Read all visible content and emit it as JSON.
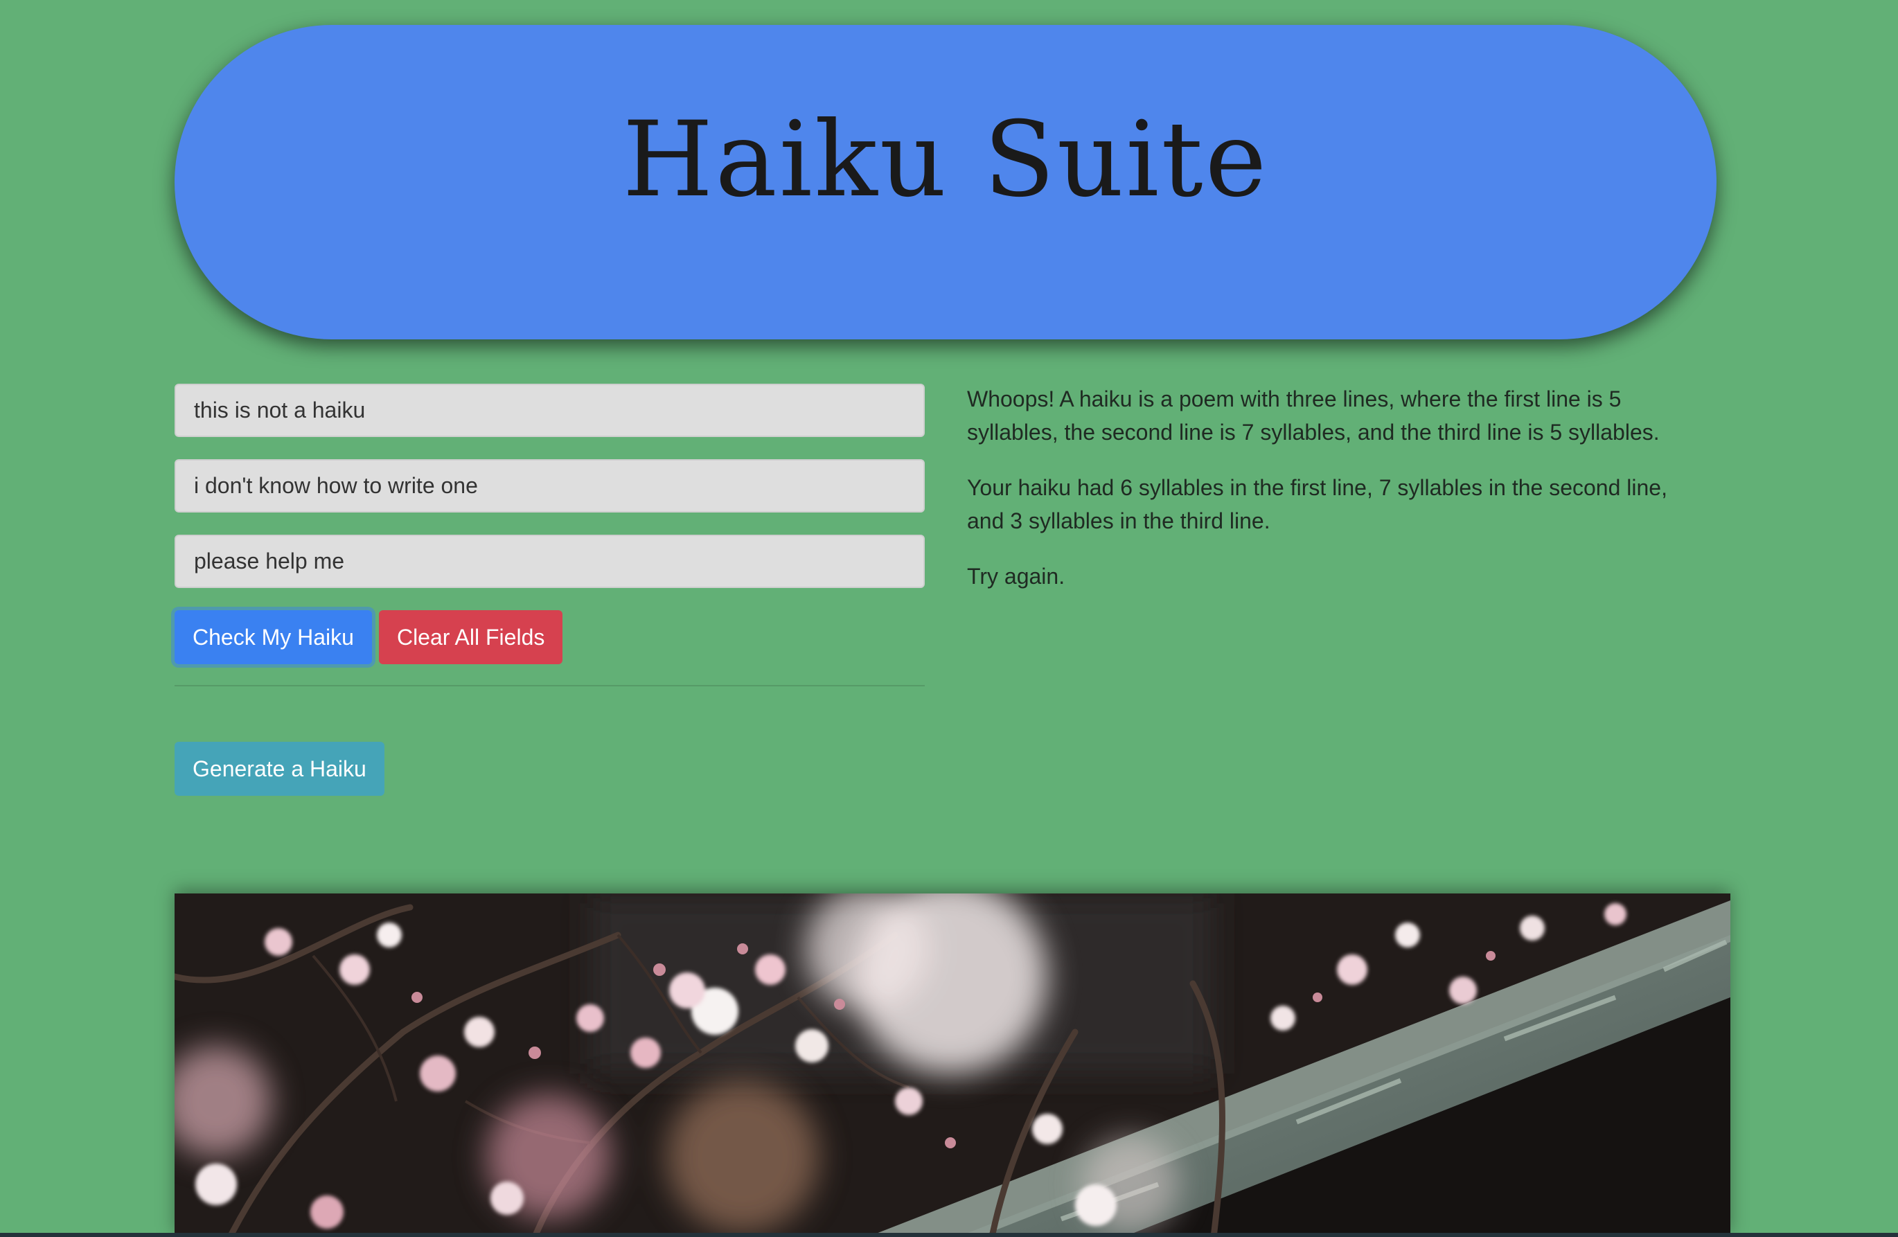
{
  "header": {
    "title": "Haiku Suite"
  },
  "form": {
    "line1_value": "this is not a haiku",
    "line2_value": "i don't know how to write one",
    "line3_value": "please help me",
    "check_label": "Check My Haiku",
    "clear_label": "Clear All Fields",
    "generate_label": "Generate a Haiku"
  },
  "result": {
    "paragraphs": [
      "Whoops! A haiku is a poem with three lines, where the first line is 5 syllables, the second line is 7 syllables, and the third line is 5 syllables.",
      "Your haiku had 6 syllables in the first line, 7 syllables in the second line, and 3 syllables in the third line.",
      "Try again."
    ]
  },
  "colors": {
    "background": "#62b076",
    "header": "#4f86ec",
    "primary": "#3a81f1",
    "danger": "#d6414f",
    "info": "#45a4b8"
  },
  "image": {
    "icon": "cherry-blossom-photo"
  }
}
